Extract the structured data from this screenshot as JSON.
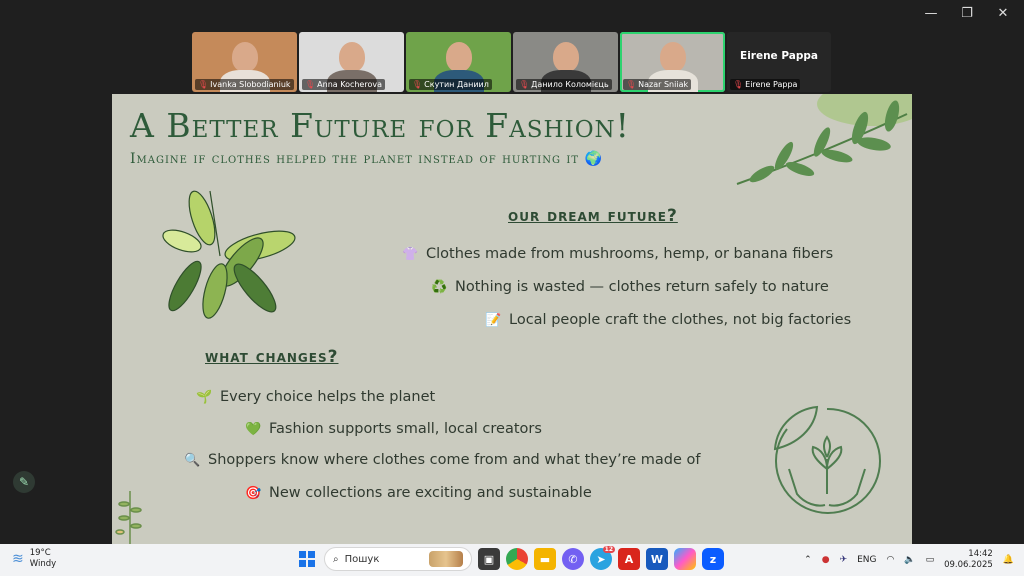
{
  "participants": [
    {
      "name": "Ivanka Slobodianiuk",
      "muted": true,
      "bg": "#c58a5a",
      "shirt": "#e8e0d8"
    },
    {
      "name": "Anna Kocherova",
      "muted": true,
      "bg": "#dcdcdc",
      "shirt": "#7a6f68"
    },
    {
      "name": "Скутин Даниил",
      "muted": true,
      "bg": "#6fa34a",
      "shirt": "#2d5a7a"
    },
    {
      "name": "Данило Коломієць",
      "muted": true,
      "bg": "#8a8a86",
      "shirt": "#3a3a3a"
    },
    {
      "name": "Nazar Sniiak",
      "muted": true,
      "bg": "#b9b7b0",
      "shirt": "#e6e2da",
      "active": true
    }
  ],
  "host_tile": {
    "big_name": "Eirene Pappa",
    "name": "Eirene Pappa",
    "muted": true
  },
  "slide": {
    "title": "A Better Future for Fashion!",
    "subtitle": "Imagine if clothes helped the planet instead of hurting it 🌍",
    "section1": "our dream future?",
    "dream": [
      {
        "icon": "👚",
        "text": "Clothes made from mushrooms, hemp, or banana fibers"
      },
      {
        "icon": "♻️",
        "text": "Nothing is wasted — clothes return safely to nature"
      },
      {
        "icon": "📝",
        "text": "Local people craft the clothes, not big factories"
      }
    ],
    "section2": "what changes?",
    "changes": [
      {
        "icon": "🌱",
        "text": "Every choice helps the planet"
      },
      {
        "icon": "💚",
        "text": "Fashion supports small, local creators"
      },
      {
        "icon": "🔍",
        "text": "Shoppers know where clothes come from and what they’re made of"
      },
      {
        "icon": "🎯",
        "text": "New collections are exciting and sustainable"
      }
    ]
  },
  "taskbar": {
    "weather_temp": "19°C",
    "weather_desc": "Windy",
    "search_placeholder": "Пошук",
    "lang": "ENG",
    "time": "14:42",
    "date": "09.06.2025",
    "telegram_badge": "12"
  },
  "colors": {
    "accent_green": "#2e5b3a",
    "slide_bg": "#cacbbf",
    "active_tile": "#2dd36f"
  }
}
